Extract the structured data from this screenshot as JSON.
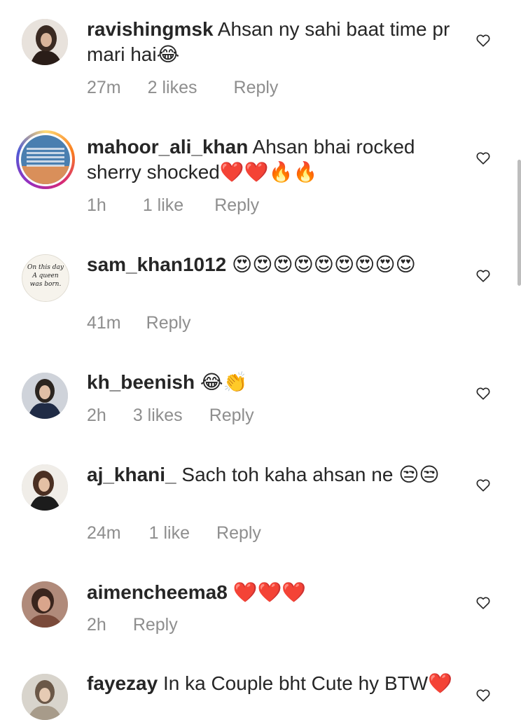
{
  "comments": [
    {
      "username": "ravishingmsk",
      "text": " Ahsan ny sahi baat time pr mari hai",
      "emoji": "😂",
      "time": "27m",
      "likes": "2 likes",
      "reply": "Reply"
    },
    {
      "username": "mahoor_ali_khan",
      "text": " Ahsan bhai rocked sherry shocked",
      "emoji": "❤️❤️🔥🔥",
      "time": "1h",
      "likes": "1 like",
      "reply": "Reply"
    },
    {
      "username": "sam_khan1012",
      "text": " ",
      "emoji": "😍😍😍😍😍😍😍😍😍",
      "time": "41m",
      "likes": "",
      "reply": "Reply",
      "avatar_text": [
        "On this day",
        "A queen",
        "was born."
      ]
    },
    {
      "username": "kh_beenish",
      "text": " ",
      "emoji": "😂👏",
      "time": "2h",
      "likes": "3 likes",
      "reply": "Reply"
    },
    {
      "username": "aj_khani_",
      "text": " Sach toh kaha ahsan ne ",
      "emoji": "😒😒",
      "time": "24m",
      "likes": "1 like",
      "reply": "Reply"
    },
    {
      "username": "aimencheema8",
      "text": " ",
      "emoji": "❤️❤️❤️",
      "time": "2h",
      "likes": "",
      "reply": "Reply"
    },
    {
      "username": "fayezay",
      "text": " In ka Couple bht Cute hy BTW",
      "emoji": "❤️",
      "time": "",
      "likes": "",
      "reply": ""
    }
  ],
  "icons": {
    "like": "heart-outline-icon"
  },
  "colors": {
    "text": "#262626",
    "meta": "#8e8e8e",
    "heart_outline": "#262626"
  }
}
